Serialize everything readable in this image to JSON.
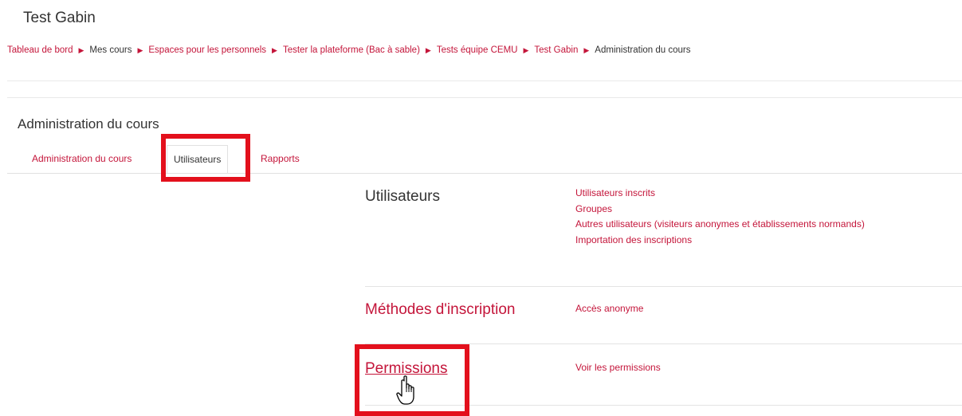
{
  "page": {
    "title": "Test Gabin"
  },
  "breadcrumb": {
    "items": [
      "Tableau de bord",
      "Mes cours",
      "Espaces pour les personnels",
      "Tester la plateforme (Bac à sable)",
      "Tests équipe CEMU",
      "Test Gabin",
      "Administration du cours"
    ],
    "separator": "▶"
  },
  "section": {
    "heading": "Administration du cours"
  },
  "tabs": [
    {
      "label": "Administration du cours",
      "active": false
    },
    {
      "label": "Utilisateurs",
      "active": true
    },
    {
      "label": "Rapports",
      "active": false
    }
  ],
  "groups": [
    {
      "title": "Utilisateurs",
      "links": [
        "Utilisateurs inscrits",
        "Groupes",
        "Autres utilisateurs (visiteurs anonymes et établissements normands)",
        "Importation des inscriptions"
      ]
    },
    {
      "title": "Méthodes d'inscription",
      "links": [
        "Accès anonyme"
      ]
    },
    {
      "title": "Permissions",
      "links": [
        "Voir les permissions"
      ]
    }
  ],
  "colors": {
    "link": "#c4153a",
    "text": "#333333",
    "highlight": "#e3101c"
  },
  "icons": {
    "separator": "triangle-right-icon",
    "cursor": "hand-pointer-icon"
  }
}
